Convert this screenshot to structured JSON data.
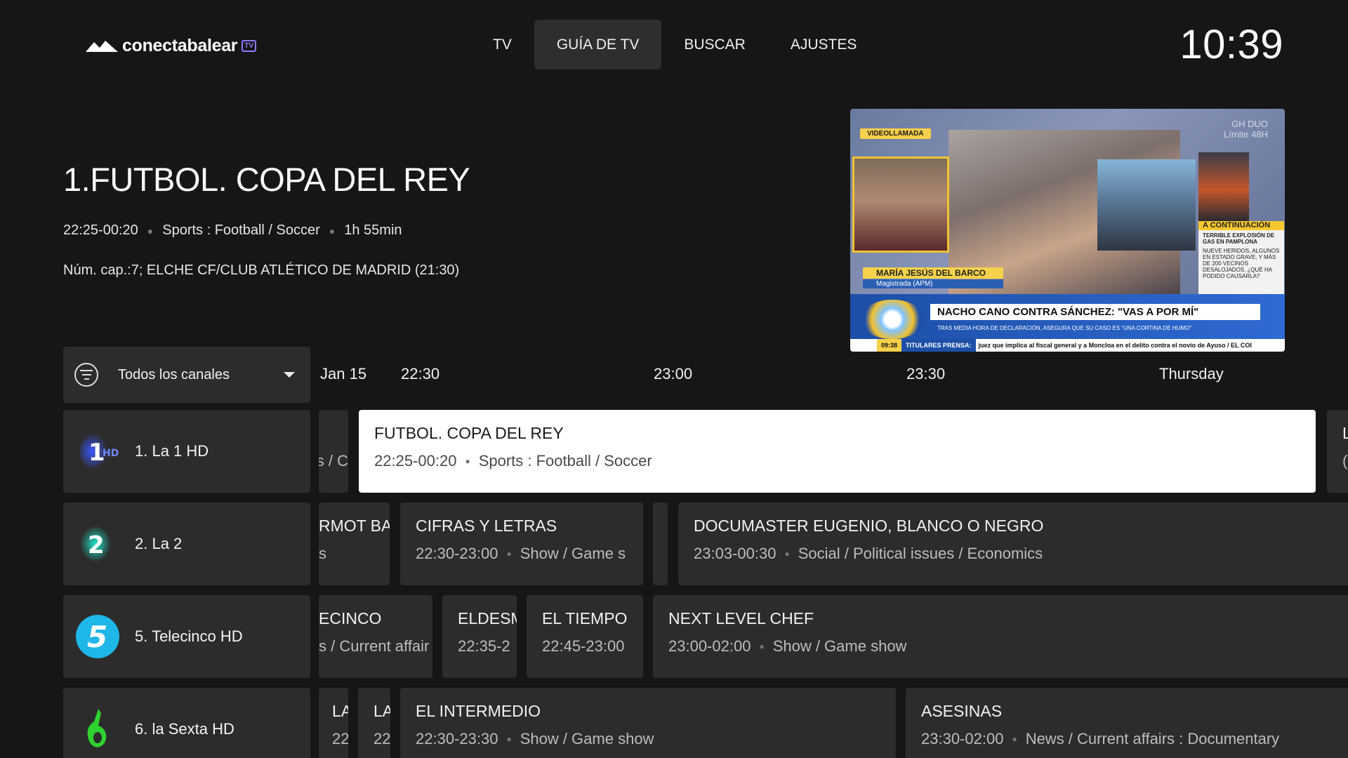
{
  "header": {
    "logo_text": "conectabalear",
    "logo_badge": "TV",
    "nav": [
      "TV",
      "GUÍA DE TV",
      "BUSCAR",
      "AJUSTES"
    ],
    "active_nav": "GUÍA DE TV",
    "clock": "10:39"
  },
  "program": {
    "title": "1.FUTBOL. COPA DEL REY",
    "time": "22:25-00:20",
    "genre": "Sports : Football / Soccer",
    "duration": "1h 55min",
    "description": "Núm. cap.:7; ELCHE CF/CLUB ATLÉTICO DE MADRID (21:30)"
  },
  "preview": {
    "badge": "VIDEOLLAMADA",
    "top_right": [
      "GH DUO",
      "Límite 48H"
    ],
    "side_head": "A CONTINUACIÓN",
    "side_title": "TERRIBLE EXPLOSIÓN DE GAS EN PAMPLONA",
    "side_text": "NUEVE HERIDOS, ALGUNOS EN ESTADO GRAVE, Y MÁS DE 200 VECINOS DESALOJADOS. ¿QUÉ HA PODIDO CAUSARLA?",
    "name": "MARÍA JESÚS DEL BARCO",
    "name_sub": "Magistrada (APM)",
    "headline": "NACHO CANO CONTRA SÁNCHEZ: \"VAS A POR MÍ\"",
    "subline": "TRAS MEDIA HORA DE DECLARACIÓN, ASEGURA QUE SU CASO ES \"UNA CORTINA DE HUMO\"",
    "ticker_time": "09:38",
    "ticker_tag": "TITULARES PRENSA:",
    "ticker_text": "juez que implica al fiscal general y a Moncloa en el delito contra el novio de Ayuso / EL COI"
  },
  "guide": {
    "filter_label": "Todos los canales",
    "date_label": "Jan 15",
    "times": [
      "22:30",
      "23:00",
      "23:30",
      "Thursday"
    ],
    "channels": [
      {
        "name": "1. La 1 HD",
        "logo": "la1-logo"
      },
      {
        "name": "2. La 2",
        "logo": "la2-logo"
      },
      {
        "name": "5. Telecinco HD",
        "logo": "telecinco-logo"
      },
      {
        "name": "6. la Sexta HD",
        "logo": "lasexta-logo"
      }
    ],
    "rows": [
      [
        {
          "title": "",
          "time": "s / C",
          "genre": ""
        },
        {
          "title": "FUTBOL. COPA DEL REY",
          "time": "22:25-00:20",
          "genre": "Sports : Football / Soccer"
        },
        {
          "title": "L",
          "time": "(",
          "genre": ""
        }
      ],
      [
        {
          "title": "RMOT BAN",
          "time": "s",
          "genre": ""
        },
        {
          "title": "CIFRAS Y LETRAS",
          "time": "22:30-23:00",
          "genre": "Show / Game s"
        },
        {
          "title": "",
          "time": "",
          "genre": ""
        },
        {
          "title": "DOCUMASTER EUGENIO, BLANCO O NEGRO",
          "time": "23:03-00:30",
          "genre": "Social / Political issues / Economics"
        }
      ],
      [
        {
          "title": "ECINCO",
          "time": "s / Current affair",
          "genre": ""
        },
        {
          "title": "ELDESM",
          "time": "22:35-2",
          "genre": ""
        },
        {
          "title": "EL TIEMPO",
          "time": "22:45-23:00",
          "genre": ""
        },
        {
          "title": "NEXT LEVEL CHEF",
          "time": "23:00-02:00",
          "genre": "Show / Game show"
        }
      ],
      [
        {
          "title": "LA",
          "time": "22",
          "genre": ""
        },
        {
          "title": "LA",
          "time": "22",
          "genre": ""
        },
        {
          "title": "EL INTERMEDIO",
          "time": "22:30-23:30",
          "genre": "Show / Game show"
        },
        {
          "title": "ASESINAS",
          "time": "23:30-02:00",
          "genre": "News / Current affairs : Documentary"
        }
      ]
    ]
  },
  "colors": {
    "background": "#161616",
    "card": "#2c2c2c",
    "selected": "#ffffff",
    "accent": "#8c7bff"
  }
}
